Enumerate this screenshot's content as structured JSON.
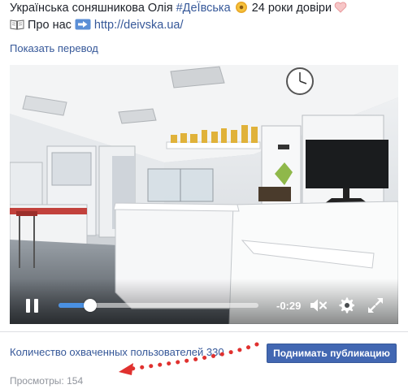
{
  "post": {
    "line1": {
      "text": "Українська соняшникова Олія ",
      "hashtag": "#ДеЇвська",
      "emoji1": "sunflower-emoji",
      "after": " 24 роки довіри",
      "emoji2": "heart-emoji"
    },
    "line2": {
      "emoji1": "book-emoji",
      "text": "Про нас",
      "emoji2": "right-arrow-emoji",
      "link": "http://deivska.ua/"
    },
    "translate_label": "Показать перевод"
  },
  "video": {
    "progress": 0.16,
    "time_remaining": "-0:29",
    "icons": [
      "pause-icon",
      "mute-icon",
      "gear-icon",
      "fullscreen-icon"
    ]
  },
  "footer": {
    "reach_label": "Количество охваченных пользователей 330",
    "boost_label": "Поднимать публикацию",
    "views_label": "Просмотры: 154"
  },
  "colors": {
    "link": "#365899",
    "boost_button": "#4267b2",
    "progress": "#4a90e2",
    "annotation": "#e0312f"
  }
}
